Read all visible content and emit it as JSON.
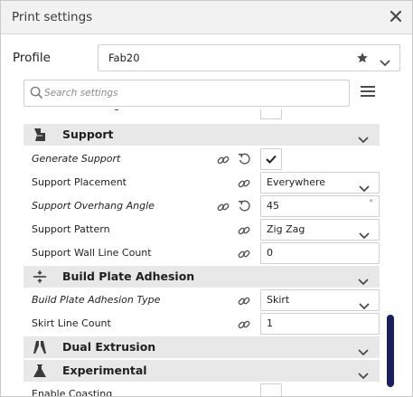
{
  "window": {
    "title": "Print settings"
  },
  "profile": {
    "label": "Profile",
    "value": "Fab20"
  },
  "search": {
    "placeholder": "Search settings"
  },
  "categories": {
    "support": "Support",
    "adhesion": "Build Plate Adhesion",
    "dual": "Dual Extrusion",
    "experimental": "Experimental"
  },
  "settings": {
    "generate_support": {
      "label": "Generate Support",
      "checked": true
    },
    "support_placement": {
      "label": "Support Placement",
      "value": "Everywhere"
    },
    "overhang_angle": {
      "label": "Support Overhang Angle",
      "value": "45",
      "unit": "°"
    },
    "support_pattern": {
      "label": "Support Pattern",
      "value": "Zig Zag"
    },
    "wall_line_count": {
      "label": "Support Wall Line Count",
      "value": "0"
    },
    "adhesion_type": {
      "label": "Build Plate Adhesion Type",
      "value": "Skirt"
    },
    "skirt_line_count": {
      "label": "Skirt Line Count",
      "value": "1"
    },
    "enable_coasting": {
      "label": "Enable Coasting"
    }
  },
  "colors": {
    "category_bg": "#e8e8e8",
    "scrollbar": "#1b1f5c"
  }
}
